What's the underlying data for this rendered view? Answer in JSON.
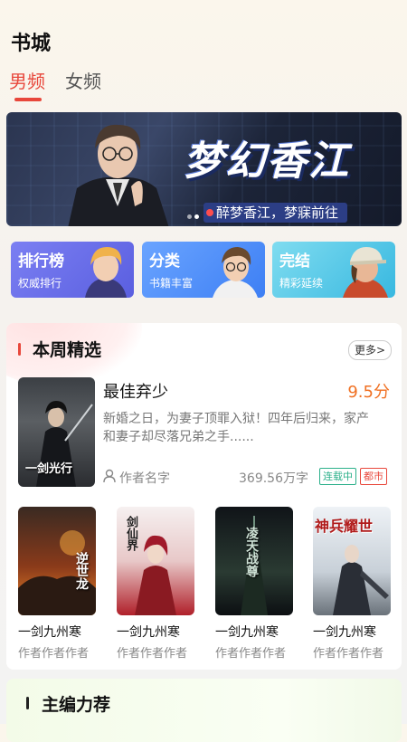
{
  "header": {
    "title": "书城"
  },
  "tabs": [
    {
      "label": "男频"
    },
    {
      "label": "女频"
    }
  ],
  "banner": {
    "title": "梦幻香江",
    "subtitle": "醉梦香江，梦寐前往"
  },
  "categories": [
    {
      "title": "排行榜",
      "subtitle": "权威排行"
    },
    {
      "title": "分类",
      "subtitle": "书籍丰富"
    },
    {
      "title": "完结",
      "subtitle": "精彩延续"
    }
  ],
  "weekly": {
    "title": "本周精选",
    "more": "更多>",
    "featured": {
      "name": "最佳弃少",
      "score": "9.5分",
      "desc": "新婚之日，为妻子顶罪入狱！四年后归来，家产和妻子却尽落兄弟之手......",
      "author": "作者名字",
      "words": "369.56万字",
      "tags": [
        "连载中",
        "都市"
      ],
      "cover_text": "一剑光行"
    },
    "books": [
      {
        "name": "一剑九州寒",
        "author": "作者作者作者",
        "cover_text": "逆世龙"
      },
      {
        "name": "一剑九州寒",
        "author": "作者作者作者",
        "cover_text": "剑仙界"
      },
      {
        "name": "一剑九州寒",
        "author": "作者作者作者",
        "cover_text": "凌天战尊"
      },
      {
        "name": "一剑九州寒",
        "author": "作者作者作者",
        "cover_text": "神兵耀世"
      }
    ]
  },
  "editor": {
    "title": "主编力荐"
  },
  "colors": {
    "accent": "#e8473b",
    "score": "#f07022",
    "tag_green": "#2bb08a"
  }
}
